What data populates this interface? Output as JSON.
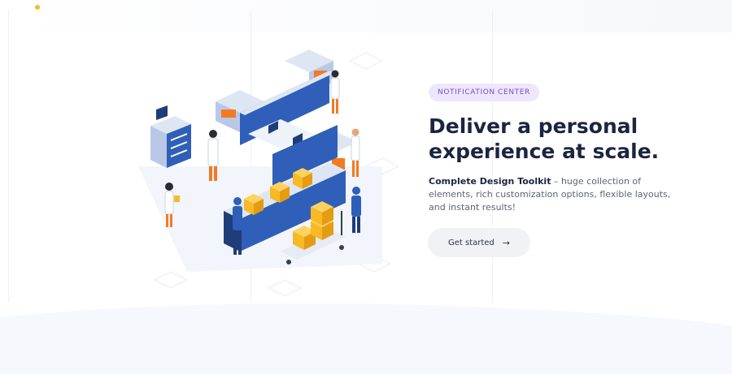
{
  "hero": {
    "badge": "NOTIFICATION CENTER",
    "headline": "Deliver a personal experience at scale.",
    "description_bold": "Complete Design Toolkit",
    "description_rest": " – huge collection of elements, rich customization options, flexible layouts, and instant results!",
    "cta_label": "Get started",
    "cta_icon": "arrow-right-icon"
  },
  "colors": {
    "accent": "#7b4ad6",
    "badge_bg": "#ede7fb",
    "headline": "#1b2540",
    "button_bg": "#f1f2f5",
    "illustration_blue": "#2f5fb8",
    "illustration_yellow": "#f7b924",
    "illustration_orange": "#f47a20"
  }
}
